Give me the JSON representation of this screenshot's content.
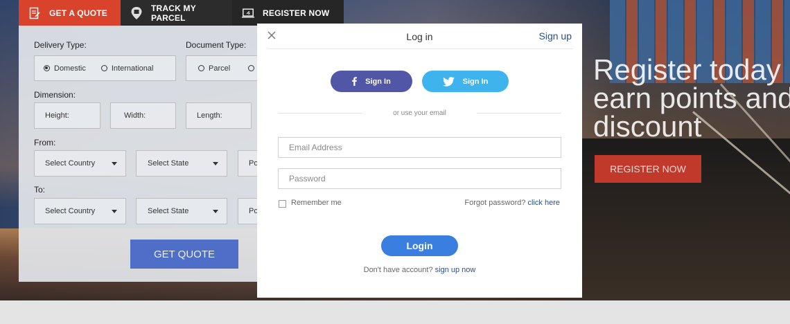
{
  "tabs": [
    {
      "label": "GET A QUOTE",
      "icon": "document-icon"
    },
    {
      "label": "TRACK MY PARCEL",
      "icon": "location-pin-icon"
    },
    {
      "label": "REGISTER NOW",
      "icon": "laptop-icon"
    }
  ],
  "quote_form": {
    "delivery_type_label": "Delivery Type:",
    "delivery_options": [
      "Domestic",
      "International"
    ],
    "delivery_selected": "Domestic",
    "document_type_label": "Document Type:",
    "document_options": [
      "Parcel"
    ],
    "dimension_label": "Dimension:",
    "height": "Height:",
    "width": "Width:",
    "length": "Length:",
    "from_label": "From:",
    "to_label": "To:",
    "select_country": "Select Country",
    "select_state": "Select State",
    "postcode_partial": "Po",
    "submit": "GET QUOTE"
  },
  "hero": {
    "line1": "Register today",
    "line2": "earn points and",
    "line3": "discount",
    "button": "REGISTER NOW"
  },
  "modal": {
    "title": "Log in",
    "signup_link": "Sign up",
    "facebook_label": "Sign In",
    "twitter_label": "Sign In",
    "divider_text": "or use your email",
    "email_placeholder": "Email Address",
    "password_placeholder": "Password",
    "remember_label": "Remember me",
    "forgot_text": "Forgot password?",
    "forgot_link": "click here",
    "login_button": "Login",
    "no_account_text": "Don't have account?",
    "signup_now_link": "sign up now"
  },
  "colors": {
    "accent_red": "#d9432b",
    "quote_blue": "#4e6ec7",
    "facebook": "#5157a6",
    "twitter": "#3fb3ee",
    "login_blue": "#3a7fe0",
    "link": "#2a4f8f"
  }
}
